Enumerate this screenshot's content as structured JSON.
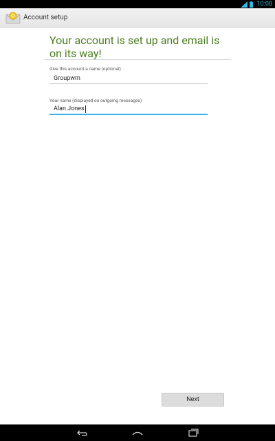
{
  "status_bar": {
    "time": "10:00"
  },
  "action_bar": {
    "title": "Account setup",
    "icon": "email-app-icon"
  },
  "content": {
    "headline": "Your account is set up and email is on its way!",
    "account_name": {
      "label": "Give this account a name (optional)",
      "value": "Groupwm"
    },
    "your_name": {
      "label": "Your name (displayed on outgoing messages)",
      "value": "Alan Jones"
    }
  },
  "footer": {
    "next_label": "Next"
  },
  "nav_bar": {
    "icons": [
      "back-icon",
      "home-icon",
      "recents-icon"
    ]
  },
  "colors": {
    "accent": "#33b5e5",
    "headline": "#4a7d1f"
  }
}
